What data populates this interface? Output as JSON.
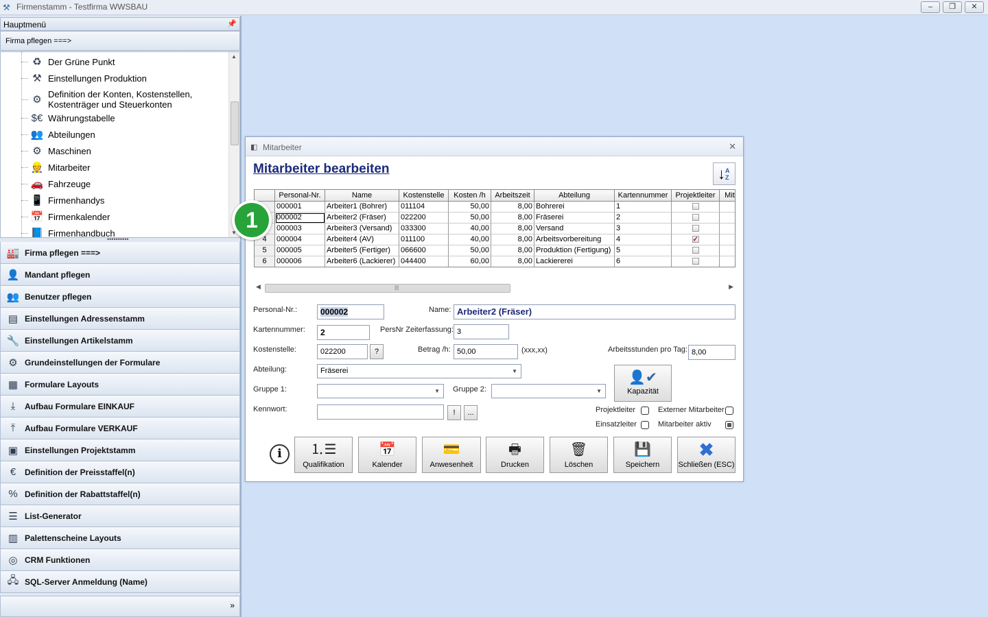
{
  "window": {
    "title": "Firmenstamm - Testfirma WWSBAU",
    "controls": [
      "‒",
      "❐",
      "✕"
    ]
  },
  "left_panel": {
    "header": "Hauptmenü",
    "pin_icon": "pin-icon",
    "section_title": "Firma pflegen   ===>",
    "tree_items": [
      {
        "label": "Der Grüne Punkt",
        "icon": "recycle-icon"
      },
      {
        "label": "Einstellungen Produktion",
        "icon": "tools-icon"
      },
      {
        "label": "Definition der Konten, Kostenstellen, Kostenträger und Steuerkonten",
        "icon": "accounts-icon"
      },
      {
        "label": "Währungstabelle",
        "icon": "currency-icon"
      },
      {
        "label": "Abteilungen",
        "icon": "departments-icon"
      },
      {
        "label": "Maschinen",
        "icon": "machines-icon"
      },
      {
        "label": "Mitarbeiter",
        "icon": "worker-icon"
      },
      {
        "label": "Fahrzeuge",
        "icon": "car-icon"
      },
      {
        "label": "Firmenhandys",
        "icon": "phone-icon"
      },
      {
        "label": "Firmenkalender",
        "icon": "calendar-icon"
      },
      {
        "label": "Firmenhandbuch",
        "icon": "book-icon"
      }
    ],
    "menu_items": [
      {
        "label": "Firma pflegen   ===>",
        "icon": "factory-icon"
      },
      {
        "label": "Mandant pflegen",
        "icon": "client-icon"
      },
      {
        "label": "Benutzer pflegen",
        "icon": "users-icon"
      },
      {
        "label": "Einstellungen Adressenstamm",
        "icon": "address-icon"
      },
      {
        "label": "Einstellungen Artikelstamm",
        "icon": "article-icon"
      },
      {
        "label": "Grundeinstellungen der Formulare",
        "icon": "form-settings-icon"
      },
      {
        "label": "Formulare Layouts",
        "icon": "layouts-icon"
      },
      {
        "label": "Aufbau Formulare EINKAUF",
        "icon": "download-icon"
      },
      {
        "label": "Aufbau Formulare VERKAUF",
        "icon": "upload-icon"
      },
      {
        "label": "Einstellungen Projektstamm",
        "icon": "project-icon"
      },
      {
        "label": "Definition der Preisstaffel(n)",
        "icon": "price-icon"
      },
      {
        "label": "Definition der Rabattstaffel(n)",
        "icon": "percent-icon"
      },
      {
        "label": "List-Generator",
        "icon": "list-icon"
      },
      {
        "label": "Palettenscheine Layouts",
        "icon": "pallet-icon"
      },
      {
        "label": "CRM Funktionen",
        "icon": "crm-icon"
      },
      {
        "label": "SQL-Server Anmeldung (Name)",
        "icon": "server-icon"
      }
    ],
    "footer_chevron": "»"
  },
  "dialog": {
    "title": "Mitarbeiter",
    "heading": "Mitarbeiter bearbeiten",
    "grid": {
      "columns": [
        "",
        "Personal-Nr.",
        "Name",
        "Kostenstelle",
        "Kosten /h",
        "Arbeitszeit",
        "Abteilung",
        "Kartennummer",
        "Projektleiter",
        "Mit"
      ],
      "rows": [
        {
          "rn": "",
          "nr": "000001",
          "name": "Arbeiter1 (Bohrer)",
          "ks": "011104",
          "kosten": "50,00",
          "az": "8,00",
          "abt": "Bohrerei",
          "karte": "1",
          "pl": false
        },
        {
          "rn": "",
          "nr": "000002",
          "name": "Arbeiter2 (Fräser)",
          "ks": "022200",
          "kosten": "50,00",
          "az": "8,00",
          "abt": "Fräserei",
          "karte": "2",
          "pl": false
        },
        {
          "rn": "",
          "nr": "000003",
          "name": "Arbeiter3 (Versand)",
          "ks": "033300",
          "kosten": "40,00",
          "az": "8,00",
          "abt": "Versand",
          "karte": "3",
          "pl": false
        },
        {
          "rn": "4",
          "nr": "000004",
          "name": "Arbeiter4 (AV)",
          "ks": "011100",
          "kosten": "40,00",
          "az": "8,00",
          "abt": "Arbeitsvorbereitung",
          "karte": "4",
          "pl": true
        },
        {
          "rn": "5",
          "nr": "000005",
          "name": "Arbeiter5 (Fertiger)",
          "ks": "066600",
          "kosten": "50,00",
          "az": "8,00",
          "abt": "Produktion (Fertigung)",
          "karte": "5",
          "pl": false
        },
        {
          "rn": "6",
          "nr": "000006",
          "name": "Arbeiter6 (Lackierer)",
          "ks": "044400",
          "kosten": "60,00",
          "az": "8,00",
          "abt": "Lackiererei",
          "karte": "6",
          "pl": false
        }
      ]
    },
    "form": {
      "personal_nr_label": "Personal-Nr.:",
      "personal_nr": "000002",
      "name_label": "Name:",
      "name": "Arbeiter2 (Fräser)",
      "kartennummer_label": "Kartennummer:",
      "kartennummer": "2",
      "persnr_label": "PersNr Zeiterfassung:",
      "persnr": "3",
      "kostenstelle_label": "Kostenstelle:",
      "kostenstelle": "022200",
      "lookup_btn": "?",
      "betrag_label": "Betrag /h:",
      "betrag": "50,00",
      "betrag_hint": "(xxx,xx)",
      "arbeitsstunden_label": "Arbeitsstunden pro Tag:",
      "arbeitsstunden": "8,00",
      "abteilung_label": "Abteilung:",
      "abteilung": "Fräserei",
      "gruppe1_label": "Gruppe 1:",
      "gruppe1": "",
      "gruppe2_label": "Gruppe 2:",
      "gruppe2": "",
      "kennwort_label": "Kennwort:",
      "kennwort": "",
      "kennwort_btn1": "!",
      "kennwort_btn2": "...",
      "kapazitaet": "Kapazität",
      "projektleiter_label": "Projektleiter",
      "externer_label": "Externer Mitarbeiter",
      "einsatzleiter_label": "Einsatzleiter",
      "aktiv_label": "Mitarbeiter aktiv"
    },
    "buttons": [
      {
        "label": "Qualifikation",
        "icon": "qualification-icon"
      },
      {
        "label": "Kalender",
        "icon": "calendar-icon"
      },
      {
        "label": "Anwesenheit",
        "icon": "attendance-icon"
      },
      {
        "label": "Drucken",
        "icon": "printer-icon"
      },
      {
        "label": "Löschen",
        "icon": "trash-icon"
      },
      {
        "label": "Speichern",
        "icon": "save-icon"
      },
      {
        "label": "Schließen (ESC)",
        "icon": "close-icon"
      }
    ]
  },
  "badge": "1"
}
